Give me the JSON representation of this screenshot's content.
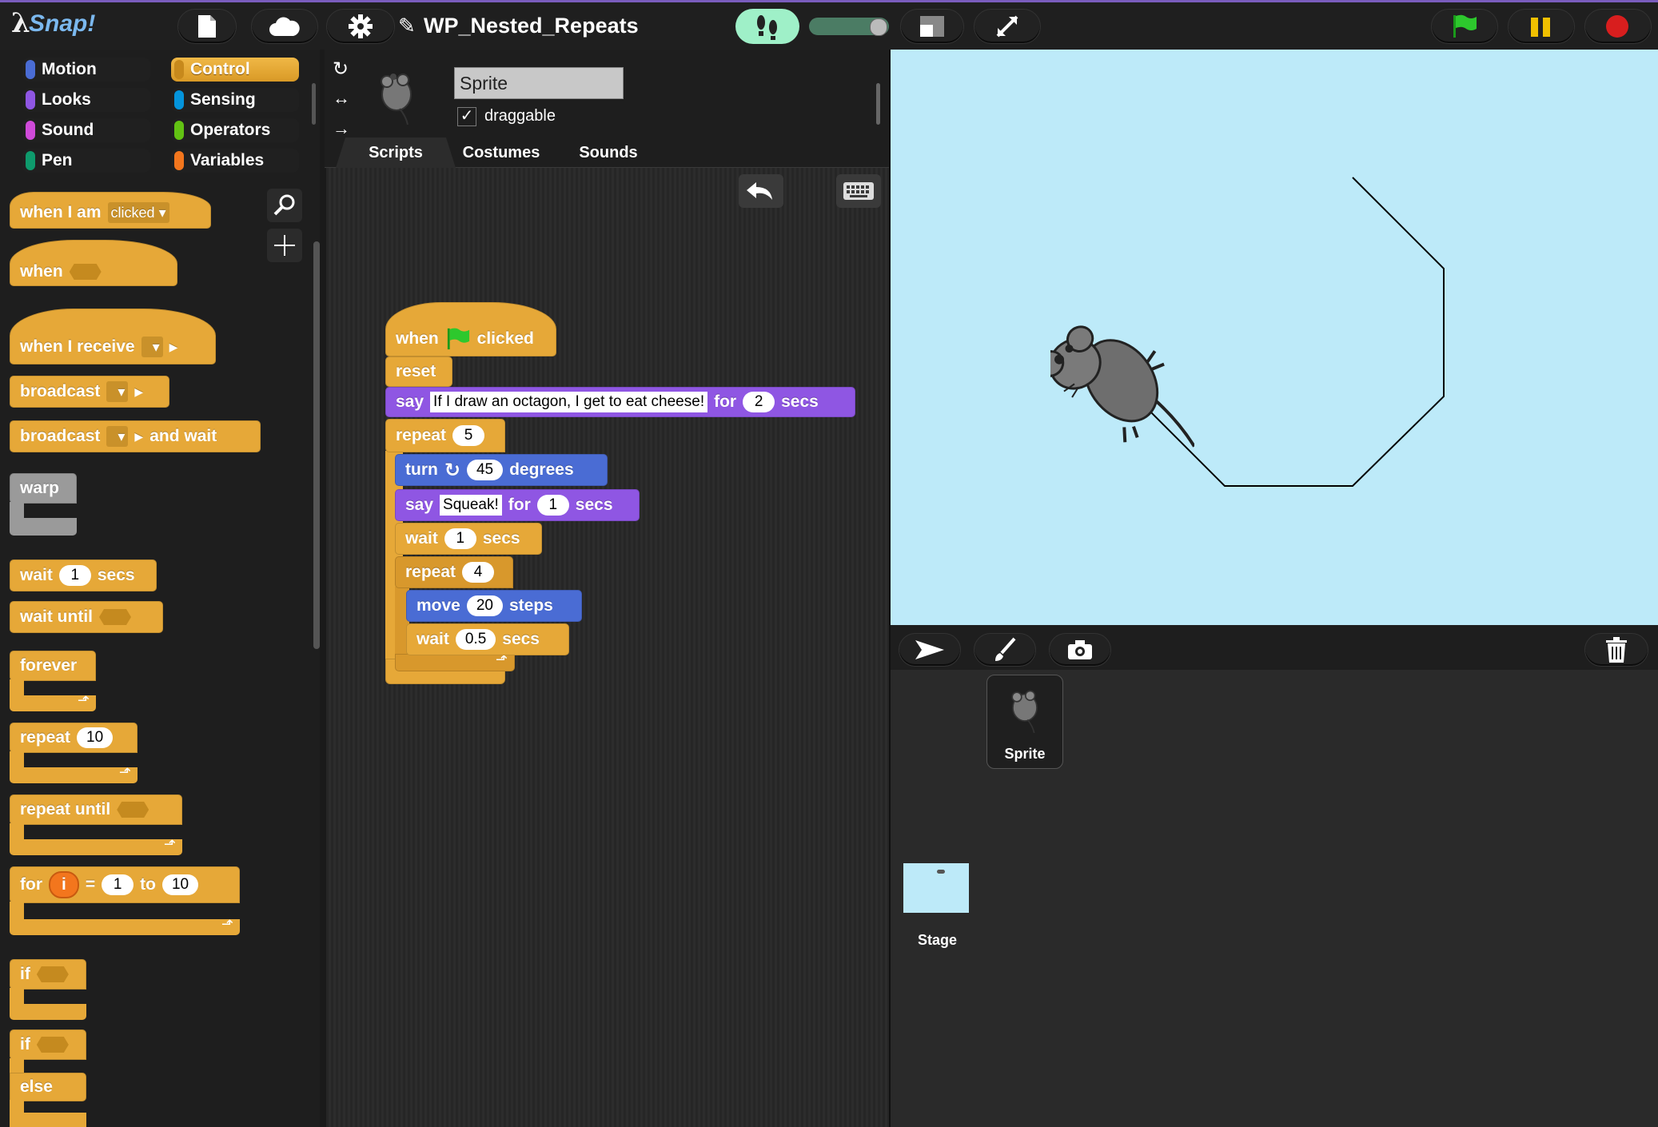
{
  "app": {
    "logo_text": "Snap!",
    "project_title": "WP_Nested_Repeats",
    "pencil_glyph": "✎"
  },
  "toolbar_icons": [
    "file-icon",
    "cloud-icon",
    "gear-icon",
    "shoes-icon",
    "slider",
    "stage-size-icon",
    "fullscreen-icon",
    "green-flag-icon",
    "pause-icon",
    "stop-icon"
  ],
  "categories": [
    {
      "label": "Motion",
      "color": "#4a6cd4"
    },
    {
      "label": "Looks",
      "color": "#8f56e3"
    },
    {
      "label": "Sound",
      "color": "#cf4ad9"
    },
    {
      "label": "Pen",
      "color": "#0e9a6c"
    },
    {
      "label": "Control",
      "color": "#e6a838",
      "selected": true
    },
    {
      "label": "Sensing",
      "color": "#0494dc"
    },
    {
      "label": "Operators",
      "color": "#62c213"
    },
    {
      "label": "Variables",
      "color": "#f3761d"
    }
  ],
  "palette": {
    "when_i_am": "when I am",
    "clicked": "clicked",
    "when": "when",
    "when_i_receive": "when I receive",
    "broadcast": "broadcast",
    "and_wait": "and wait",
    "warp": "warp",
    "wait": "wait",
    "wait_value": "1",
    "secs": "secs",
    "wait_until": "wait until",
    "forever": "forever",
    "repeat": "repeat",
    "repeat_value": "10",
    "repeat_until": "repeat until",
    "for": "for",
    "for_var": "i",
    "equals": "=",
    "for_from": "1",
    "to": "to",
    "for_to": "10",
    "if": "if",
    "else": "else"
  },
  "sprite": {
    "name": "Sprite",
    "draggable_label": "draggable",
    "draggable_checked": "✓"
  },
  "tabs": [
    "Scripts",
    "Costumes",
    "Sounds"
  ],
  "script": {
    "hat_when": "when",
    "hat_clicked": "clicked",
    "reset": "reset",
    "say": "say",
    "say_text": "If I draw an octagon, I get to eat cheese!",
    "for": "for",
    "say_secs_value": "2",
    "secs": "secs",
    "repeat": "repeat",
    "outer_repeat_value": "5",
    "turn": "turn",
    "turn_value": "45",
    "degrees": "degrees",
    "say2_text": "Squeak!",
    "say2_secs": "1",
    "wait": "wait",
    "wait_value": "1",
    "inner_repeat_value": "4",
    "move": "move",
    "move_value": "20",
    "steps": "steps",
    "wait2_value": "0.5"
  },
  "corral": {
    "sprite_label": "Sprite",
    "stage_label": "Stage"
  }
}
